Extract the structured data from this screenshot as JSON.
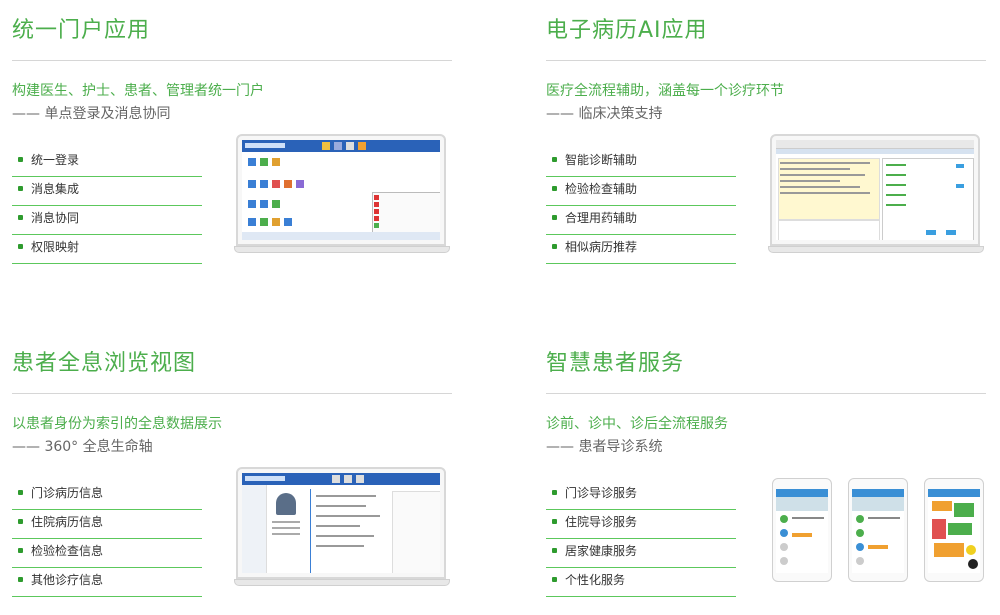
{
  "sections": [
    {
      "title": "统一门户应用",
      "subtitle": "构建医生、护士、患者、管理者统一门户",
      "tagline": "—— 单点登录及消息协同",
      "items": [
        "统一登录",
        "消息集成",
        "消息协同",
        "权限映射"
      ]
    },
    {
      "title": "电子病历AI应用",
      "subtitle": "医疗全流程辅助，涵盖每一个诊疗环节",
      "tagline": "—— 临床决策支持",
      "items": [
        "智能诊断辅助",
        "检验检查辅助",
        "合理用药辅助",
        "相似病历推荐"
      ]
    },
    {
      "title": "患者全息浏览视图",
      "subtitle": "以患者身份为索引的全息数据展示",
      "tagline": "—— 360°  全息生命轴",
      "items": [
        "门诊病历信息",
        "住院病历信息",
        "检验检查信息",
        "其他诊疗信息"
      ]
    },
    {
      "title": "智慧患者服务",
      "subtitle": "诊前、诊中、诊后全流程服务",
      "tagline": "—— 患者导诊系统",
      "items": [
        "门诊导诊服务",
        "住院导诊服务",
        "居家健康服务",
        "个性化服务"
      ]
    }
  ],
  "colors": {
    "accent": "#4cae4c",
    "bullet": "#2e9b2e",
    "rule": "#5cc85c",
    "app_header": "#2a62b8"
  }
}
